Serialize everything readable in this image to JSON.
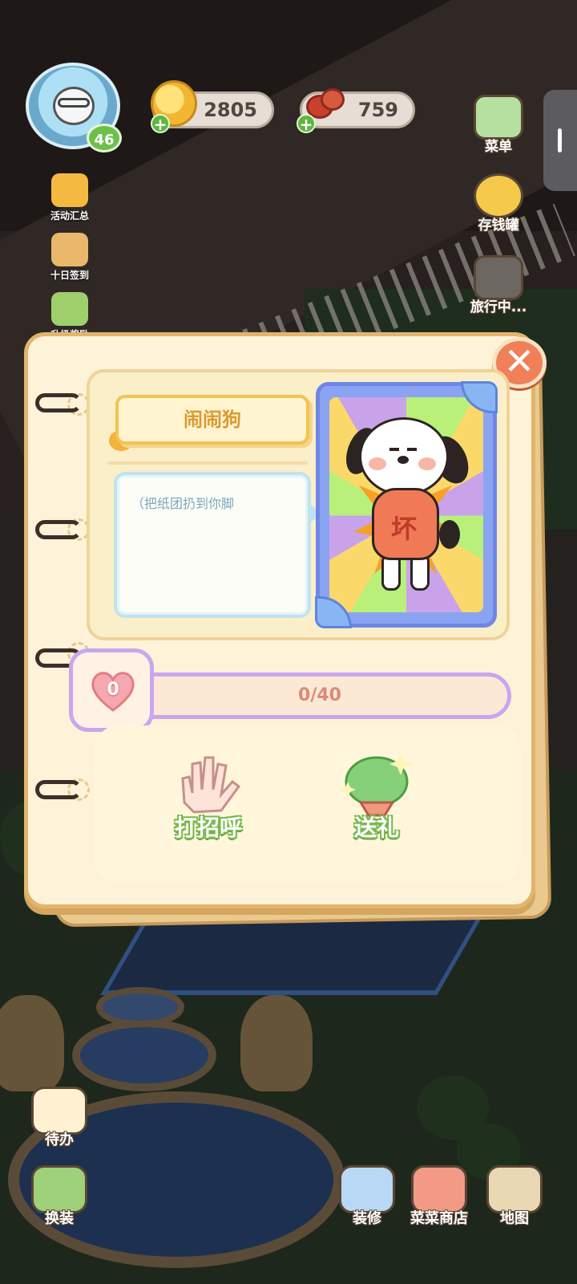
{
  "hud": {
    "level": "46",
    "coins": "2805",
    "food": "759"
  },
  "left_menu": [
    {
      "label": "活动汇总",
      "icon": "event-summary-icon"
    },
    {
      "label": "十日签到",
      "icon": "ten-day-checkin-icon"
    },
    {
      "label": "升级奖励",
      "icon": "level-reward-icon"
    }
  ],
  "right_menu": [
    {
      "label": "菜单",
      "icon": "menu-icon"
    },
    {
      "label": "存钱罐",
      "icon": "piggy-bank-icon"
    },
    {
      "label": "旅行中...",
      "icon": "camera-icon"
    }
  ],
  "bottom_left": [
    {
      "label": "待办",
      "icon": "todo-icon"
    },
    {
      "label": "换装",
      "icon": "outfit-icon"
    }
  ],
  "bottom_right": [
    {
      "label": "装修",
      "icon": "decorate-icon"
    },
    {
      "label": "菜菜商店",
      "icon": "shop-icon"
    },
    {
      "label": "地图",
      "icon": "map-icon"
    }
  ],
  "dialog": {
    "character_name": "闹闹狗",
    "speech": "（把纸团扔到你脚",
    "shirt_text": "坏",
    "affection_level": "0",
    "affection_progress": "0/40",
    "affection_fraction": 0,
    "actions": {
      "greet_label": "打招呼",
      "gift_label": "送礼"
    }
  },
  "colors": {
    "affection_border": "#c9a6ee",
    "action_text_outline": "#79b94e",
    "close_button": "#f08058"
  }
}
